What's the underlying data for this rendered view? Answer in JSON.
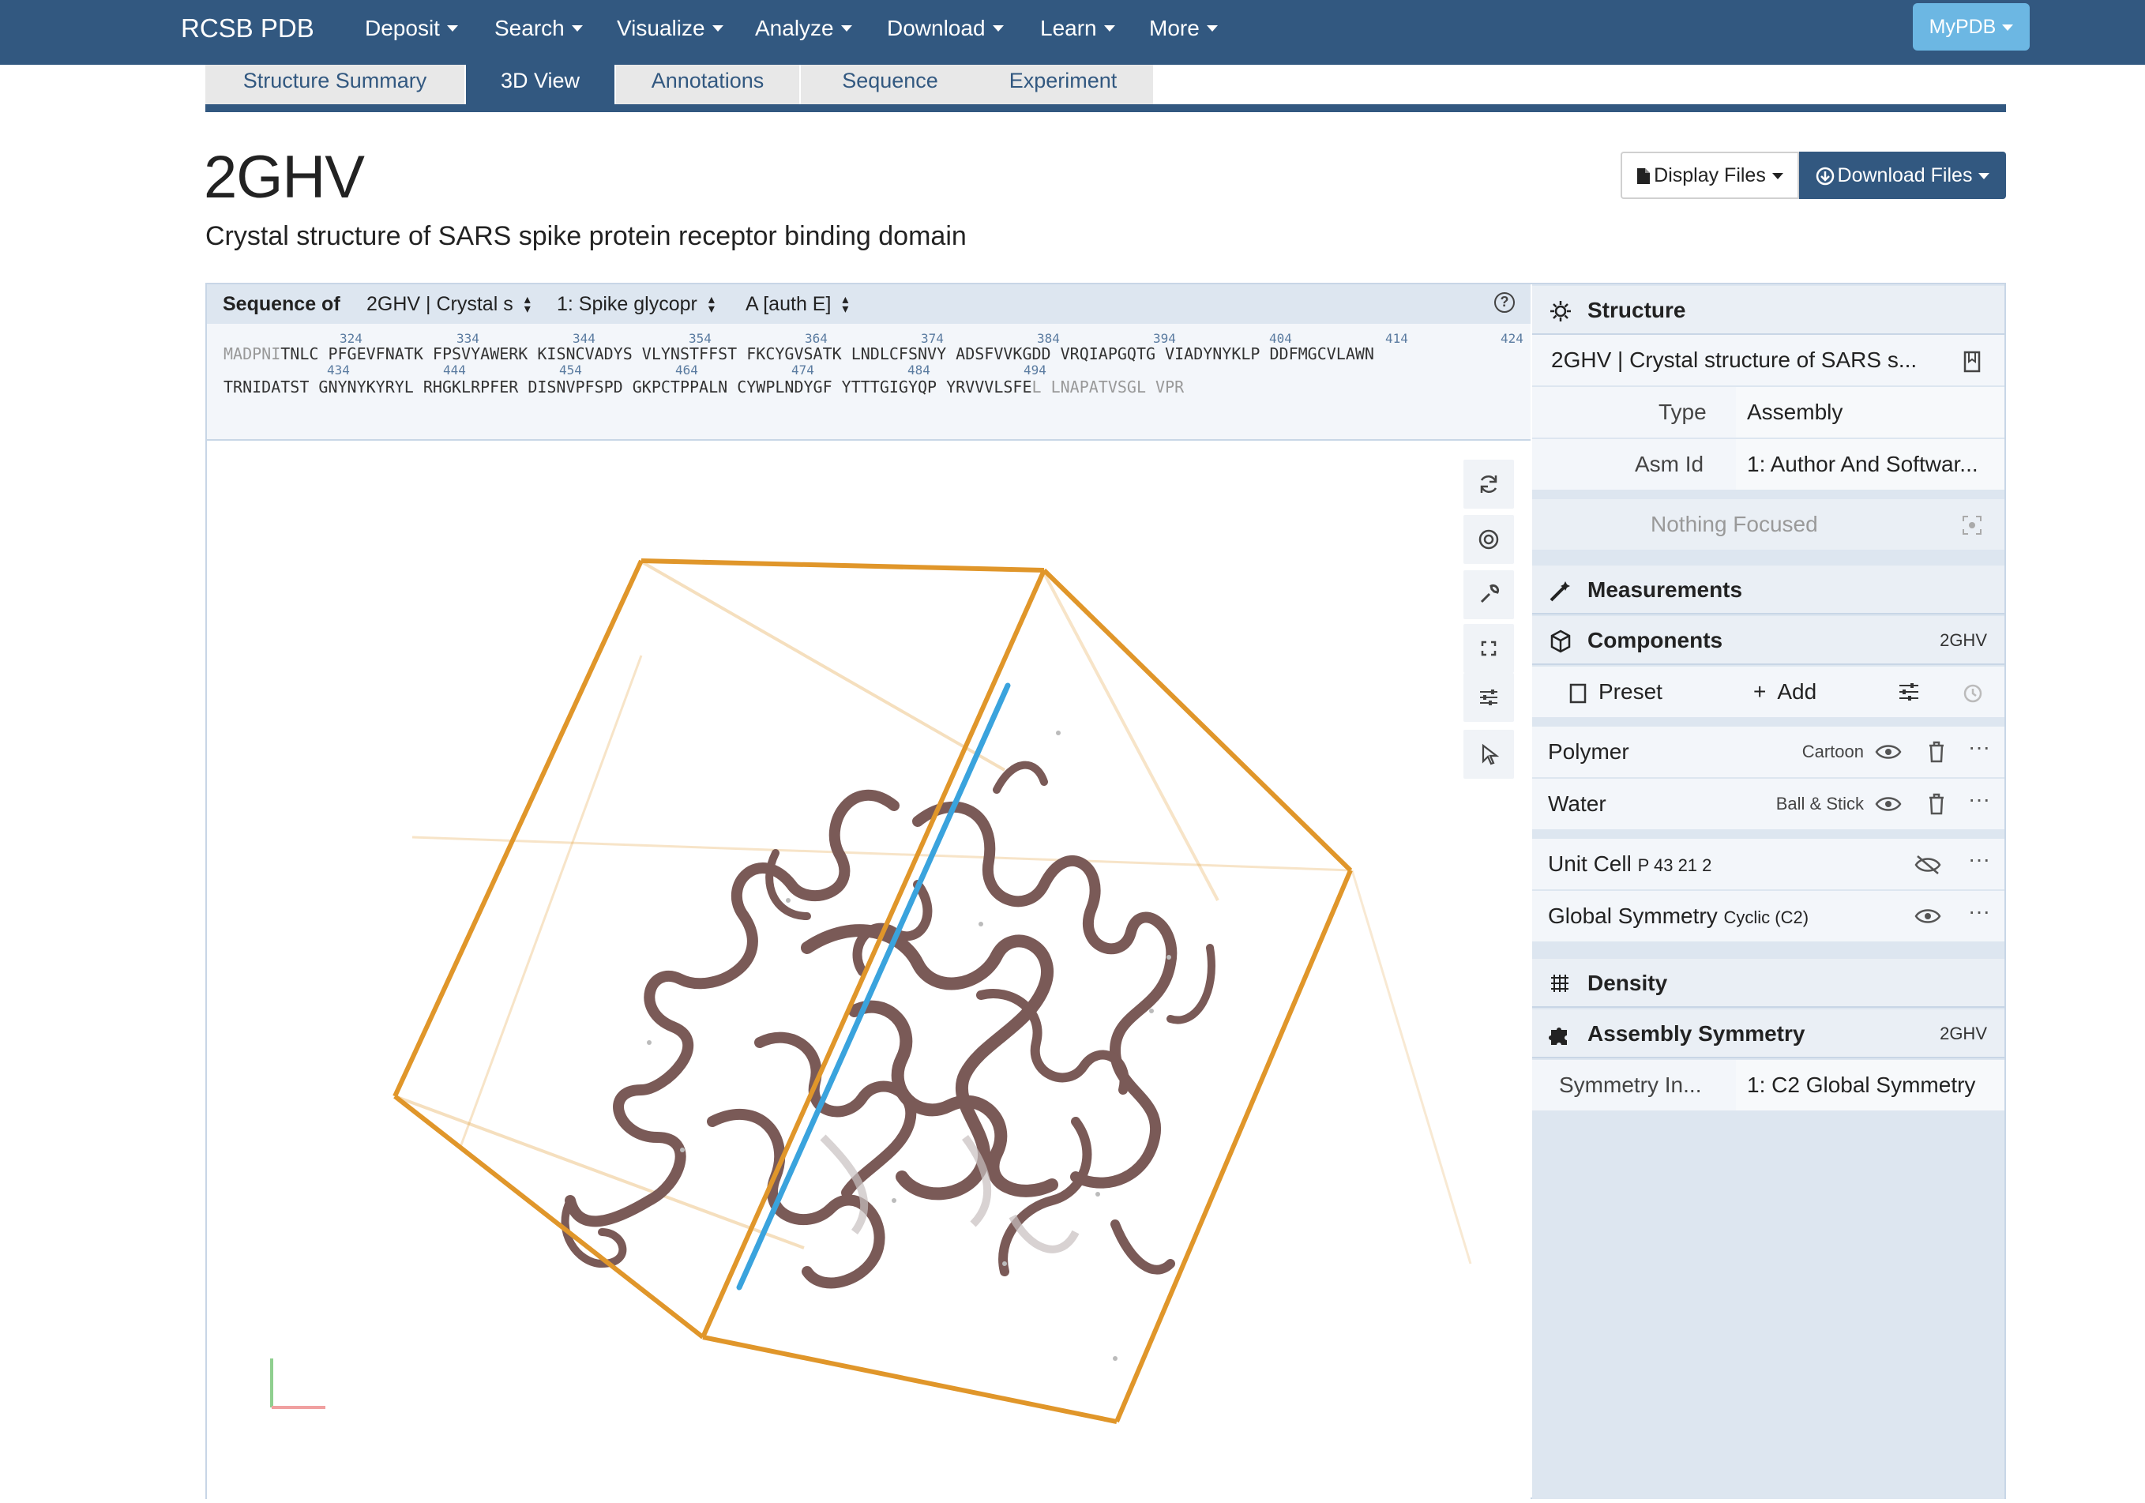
{
  "nav": {
    "brand": "RCSB PDB",
    "items": [
      "Deposit",
      "Search",
      "Visualize",
      "Analyze",
      "Download",
      "Learn",
      "More"
    ],
    "mypdb": "MyPDB"
  },
  "tabs": [
    "Structure Summary",
    "3D View",
    "Annotations",
    "Sequence",
    "Experiment"
  ],
  "active_tab": "3D View",
  "entry": {
    "id": "2GHV",
    "title": "Crystal structure of SARS spike protein receptor binding domain"
  },
  "buttons": {
    "display_files": "Display Files",
    "download_files": "Download Files"
  },
  "sequence": {
    "label": "Sequence of",
    "entity_select": "2GHV | Crystal s",
    "molecule_select": "1: Spike glycopr",
    "chain_select": "A [auth E]",
    "line1_grey": "MADPNI",
    "line1": "TNLC PFGEVFNATK FPSVYAWERK KISNCVADYS VLYNSTFFST FKCYGVSATK LNDLCFSNVY ADSFVVKGDD VRQIAPGQTG VIADYNYKLP DDFMGCVLAWN",
    "line2": "TRNIDATST GNYNYKYRYL RHGKLRPFER DISNVPFSPD GKPCTPPALN CYWPLNDYGF YTTTGIGYQP YRVVVLSFE",
    "line2_grey": "L LNAPATVSGL VPR",
    "numbers_row1": [
      "324",
      "334",
      "344",
      "354",
      "364",
      "374",
      "384",
      "394",
      "404",
      "414",
      "424"
    ],
    "numbers_row2": [
      "434",
      "444",
      "454",
      "464",
      "474",
      "484",
      "494"
    ]
  },
  "panel": {
    "structure": {
      "header": "Structure",
      "name": "2GHV | Crystal structure of SARS s...",
      "type_label": "Type",
      "type_value": "Assembly",
      "asm_label": "Asm Id",
      "asm_value": "1: Author And Softwar...",
      "focus": "Nothing Focused"
    },
    "measurements": {
      "header": "Measurements"
    },
    "components": {
      "header": "Components",
      "tag": "2GHV",
      "preset": "Preset",
      "add": "Add",
      "items": [
        {
          "name": "Polymer",
          "repr": "Cartoon"
        },
        {
          "name": "Water",
          "repr": "Ball & Stick"
        }
      ],
      "unit_cell": {
        "name": "Unit Cell",
        "detail": "P 43 21 2"
      },
      "global_symmetry": {
        "name": "Global Symmetry",
        "detail": "Cyclic (C2)"
      }
    },
    "density": {
      "header": "Density"
    },
    "assembly_symmetry": {
      "header": "Assembly Symmetry",
      "tag": "2GHV",
      "label": "Symmetry In...",
      "value": "1: C2 Global Symmetry"
    }
  },
  "colors": {
    "nav_bg": "#325880",
    "mypdb_bg": "#6cb7e3",
    "unit_cell": "#e0962a",
    "symmetry_axis": "#3aa3dd",
    "protein": "#7a5a57",
    "panel_bg": "#dde6f0"
  },
  "icons": [
    "caret-down-icon",
    "file-icon",
    "download-circle-icon",
    "help-icon",
    "reset-view-icon",
    "screenshot-icon",
    "wrench-icon",
    "fullscreen-icon",
    "settings-sliders-icon",
    "pointer-icon",
    "gear-icon",
    "bookmark-icon",
    "focus-icon",
    "ruler-icon",
    "cube-icon",
    "plus-icon",
    "history-icon",
    "eye-icon",
    "eye-slash-icon",
    "trash-icon",
    "ellipsis-icon",
    "grid-icon",
    "puzzle-icon"
  ]
}
